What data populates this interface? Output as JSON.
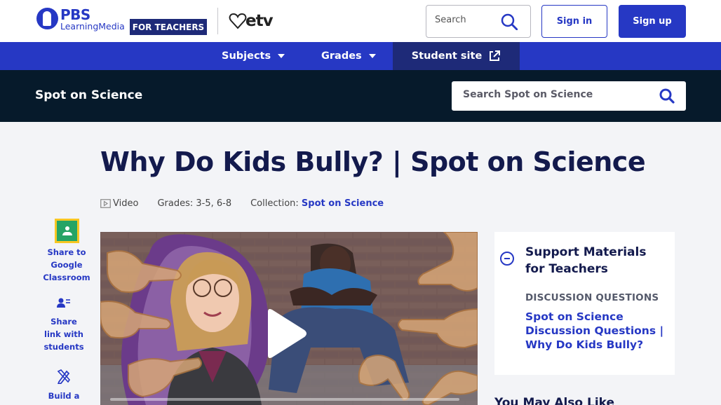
{
  "header": {
    "logo_pbs": "PBS",
    "logo_learning_media": "LearningMedia",
    "for_teachers": "FOR TEACHERS",
    "etv_logo": "etv",
    "search_placeholder": "Search",
    "sign_in": "Sign in",
    "sign_up": "Sign up"
  },
  "nav": {
    "subjects": "Subjects",
    "grades": "Grades",
    "student_site": "Student site"
  },
  "collection_bar": {
    "title": "Spot on Science",
    "search_placeholder": "Search Spot on Science"
  },
  "resource": {
    "title": "Why Do Kids Bully? | Spot on Science",
    "type": "Video",
    "grades": "Grades: 3-5, 6-8",
    "collection_label": "Collection:",
    "collection_link": "Spot on Science"
  },
  "share": {
    "google_classroom": "Share to Google Classroom",
    "link_students": "Share link with students",
    "build": "Build a"
  },
  "support": {
    "title": "Support Materials for Teachers",
    "section_label": "DISCUSSION QUESTIONS",
    "link": "Spot on Science Discussion Questions | Why Do Kids Bully?"
  },
  "also_like": "You May Also Like",
  "colors": {
    "brand_blue": "#2638c4",
    "navy": "#1e2a78",
    "dark_bar": "#061a2b",
    "title_navy": "#131a4d"
  },
  "icons": {
    "search": "search-icon",
    "external": "external-link-icon",
    "video": "video-icon",
    "play": "play-icon",
    "google_classroom": "google-classroom-icon",
    "share_link": "share-link-icon",
    "build": "build-lesson-icon",
    "collapse": "minus-circle-icon"
  }
}
